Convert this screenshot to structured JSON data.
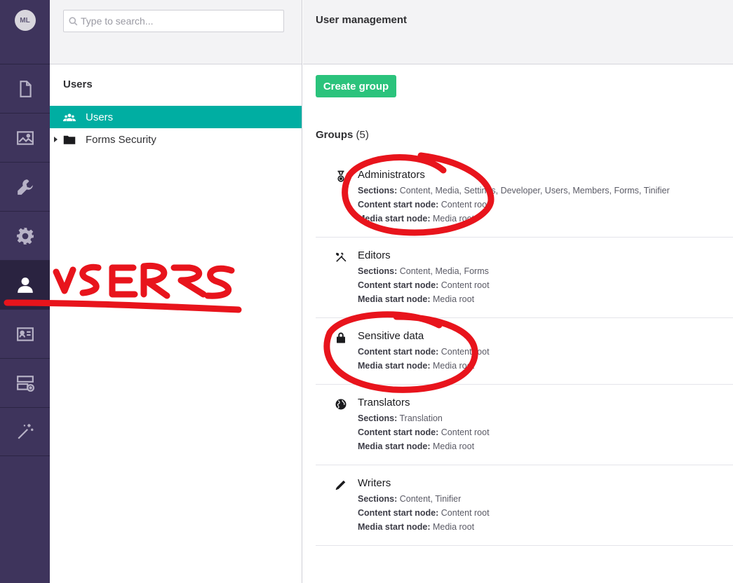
{
  "user": {
    "initials": "ML"
  },
  "rail": {
    "items": [
      {
        "name": "content",
        "icon": "document-icon"
      },
      {
        "name": "media",
        "icon": "image-icon"
      },
      {
        "name": "settings",
        "icon": "wrench-icon"
      },
      {
        "name": "developer",
        "icon": "gear-icon"
      },
      {
        "name": "users",
        "icon": "user-icon"
      },
      {
        "name": "members",
        "icon": "id-card-icon"
      },
      {
        "name": "forms",
        "icon": "form-icon"
      },
      {
        "name": "tinifier",
        "icon": "magic-wand-icon"
      }
    ]
  },
  "search": {
    "placeholder": "Type to search..."
  },
  "tree": {
    "title": "Users",
    "nodes": [
      {
        "label": "Users",
        "icon": "users-icon",
        "active": true
      },
      {
        "label": "Forms Security",
        "icon": "folder-icon",
        "active": false
      }
    ]
  },
  "main": {
    "title": "User management",
    "create_button": "Create group",
    "groups_label": "Groups",
    "groups_count": "(5)",
    "groups": [
      {
        "name": "Administrators",
        "icon": "medal-icon",
        "sections_label": "Sections:",
        "sections": "Content, Media, Settings, Developer, Users, Members, Forms, Tinifier",
        "content_label": "Content start node:",
        "content": "Content root",
        "media_label": "Media start node:",
        "media": "Media root"
      },
      {
        "name": "Editors",
        "icon": "tools-icon",
        "sections_label": "Sections:",
        "sections": "Content, Media, Forms",
        "content_label": "Content start node:",
        "content": "Content root",
        "media_label": "Media start node:",
        "media": "Media root"
      },
      {
        "name": "Sensitive data",
        "icon": "lock-icon",
        "content_label": "Content start node:",
        "content": "Content root",
        "media_label": "Media start node:",
        "media": "Media root"
      },
      {
        "name": "Translators",
        "icon": "globe-icon",
        "sections_label": "Sections:",
        "sections": "Translation",
        "content_label": "Content start node:",
        "content": "Content root",
        "media_label": "Media start node:",
        "media": "Media root"
      },
      {
        "name": "Writers",
        "icon": "pencil-icon",
        "sections_label": "Sections:",
        "sections": "Content, Tinifier",
        "content_label": "Content start node:",
        "content": "Content root",
        "media_label": "Media start node:",
        "media": "Media root"
      }
    ]
  },
  "annotation": {
    "text": "USERS",
    "color": "#e8141c"
  },
  "colors": {
    "rail": "#3e345c",
    "active_tree": "#00aea2",
    "create_button": "#2bc37c"
  }
}
